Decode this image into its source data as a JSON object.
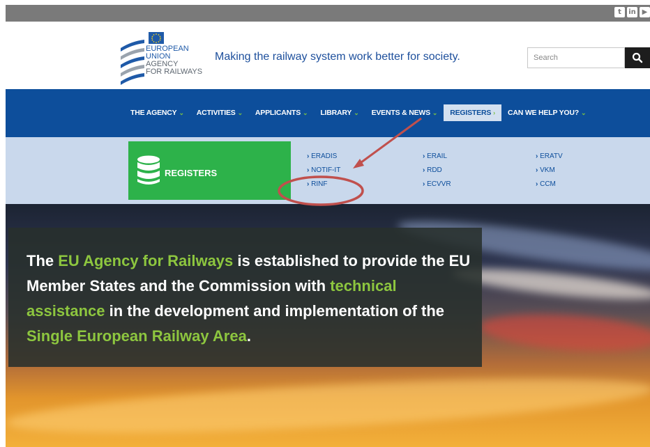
{
  "social": {
    "twitter": "t",
    "linkedin": "in",
    "youtube": "▶"
  },
  "logo": {
    "line1": "EUROPEAN",
    "line2": "UNION",
    "line3": "AGENCY",
    "line4": "FOR RAILWAYS"
  },
  "tagline": "Making the railway system work better for society.",
  "search": {
    "placeholder": "Search"
  },
  "nav": {
    "items": [
      {
        "label": "THE AGENCY"
      },
      {
        "label": "ACTIVITIES"
      },
      {
        "label": "APPLICANTS"
      },
      {
        "label": "LIBRARY"
      },
      {
        "label": "EVENTS & NEWS"
      },
      {
        "label": "REGISTERS"
      },
      {
        "label": "CAN WE HELP YOU?"
      }
    ]
  },
  "dropdown": {
    "title": "REGISTERS",
    "col1": [
      "ERADIS",
      "NOTIF-IT",
      "RINF"
    ],
    "col2": [
      "ERAIL",
      "RDD",
      "ECVVR"
    ],
    "col3": [
      "ERATV",
      "VKM",
      "CCM"
    ]
  },
  "hero": {
    "t1": "The ",
    "h1": "EU Agency for Railways",
    "t2": " is established to provide the EU Member States and the Commission with ",
    "h2": "technical assistance",
    "t3": " in the development and implementation of the ",
    "h3": "Single European Railway Area",
    "t4": "."
  },
  "colors": {
    "nav_bg": "#0d4e9b",
    "accent_green": "#2db24a",
    "highlight": "#8dc63f",
    "annotation": "#c0504d"
  }
}
